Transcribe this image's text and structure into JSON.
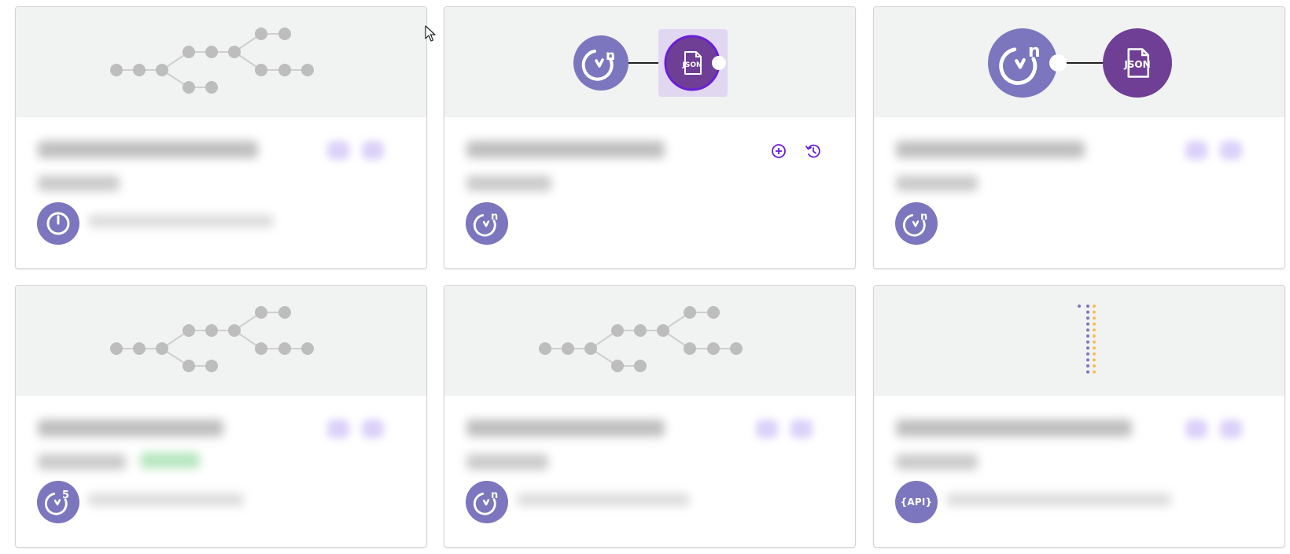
{
  "colors": {
    "node_purple": "#7b76bd",
    "json_purple": "#6f3f96",
    "accent_violet": "#6a1fd6",
    "preview_bg": "#f1f2f2",
    "graph_gray": "#bdbdbd"
  },
  "cards": [
    {
      "id": "card-1",
      "preview": "node-graph",
      "avatar_icon": "clock-icon",
      "actions_hidden": true
    },
    {
      "id": "card-2",
      "preview": "n-to-json",
      "avatar_icon": "n-clock-icon",
      "actions": [
        "add-circle-icon",
        "history-icon"
      ],
      "json_label": "JSON",
      "hovered": true
    },
    {
      "id": "card-3",
      "preview": "n-to-json-large",
      "avatar_icon": "n-clock-icon",
      "json_label": "JSON",
      "actions_hidden": true
    },
    {
      "id": "card-4",
      "preview": "node-graph",
      "avatar_icon": "five-clock-icon",
      "avatar_digit": "5",
      "actions_hidden": true,
      "has_status_badge": true
    },
    {
      "id": "card-5",
      "preview": "node-graph",
      "avatar_icon": "n-clock-icon",
      "actions_hidden": true
    },
    {
      "id": "card-6",
      "preview": "dotted-columns",
      "avatar_icon": "api-icon",
      "avatar_text": "{API}",
      "actions_hidden": true
    }
  ]
}
